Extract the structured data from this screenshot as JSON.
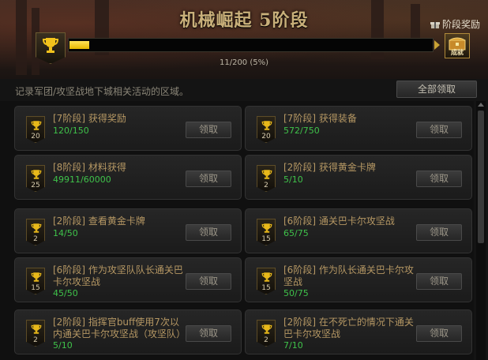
{
  "header": {
    "title": "机械崛起 5阶段",
    "stage_reward_label": "阶段奖励",
    "chest_label": "成就"
  },
  "progress": {
    "text": "11/200 (5%)",
    "fraction": 0.055
  },
  "description": "记录军团/攻坚战地下城相关活动的区域。",
  "claim_all_label": "全部领取",
  "claim_label": "领取",
  "colors": {
    "accent_gold": "#c9b07a",
    "progress_fill": "#f2cc20",
    "progress_green": "#3fc24a",
    "card_title": "#b59763"
  },
  "items": [
    {
      "title": "[7阶段] 获得奖励",
      "progress": "120/150",
      "level": "20",
      "claim": "领取"
    },
    {
      "title": "[7阶段] 获得装备",
      "progress": "572/750",
      "level": "20",
      "claim": "领取"
    },
    {
      "title": "[8阶段] 材料获得",
      "progress": "49911/60000",
      "level": "25",
      "claim": "领取"
    },
    {
      "title": "[2阶段] 获得黄金卡牌",
      "progress": "5/10",
      "level": "2",
      "claim": "领取"
    },
    {
      "title": "[2阶段] 查看黄金卡牌",
      "progress": "14/50",
      "level": "2",
      "claim": "领取"
    },
    {
      "title": "[6阶段] 通关巴卡尔攻坚战",
      "progress": "65/75",
      "level": "15",
      "claim": "领取"
    },
    {
      "title": "[6阶段] 作为攻坚队队长通关巴卡尔攻坚战",
      "progress": "45/50",
      "level": "15",
      "claim": "领取"
    },
    {
      "title": "[6阶段] 作为队长通关巴卡尔攻坚战",
      "progress": "50/75",
      "level": "15",
      "claim": "领取"
    },
    {
      "title": "[2阶段] 指挥官buff使用7次以内通关巴卡尔攻坚战（攻坚队）",
      "progress": "5/10",
      "level": "2",
      "claim": "领取"
    },
    {
      "title": "[2阶段] 在不死亡的情况下通关巴卡尔攻坚战",
      "progress": "7/10",
      "level": "2",
      "claim": "领取"
    }
  ]
}
